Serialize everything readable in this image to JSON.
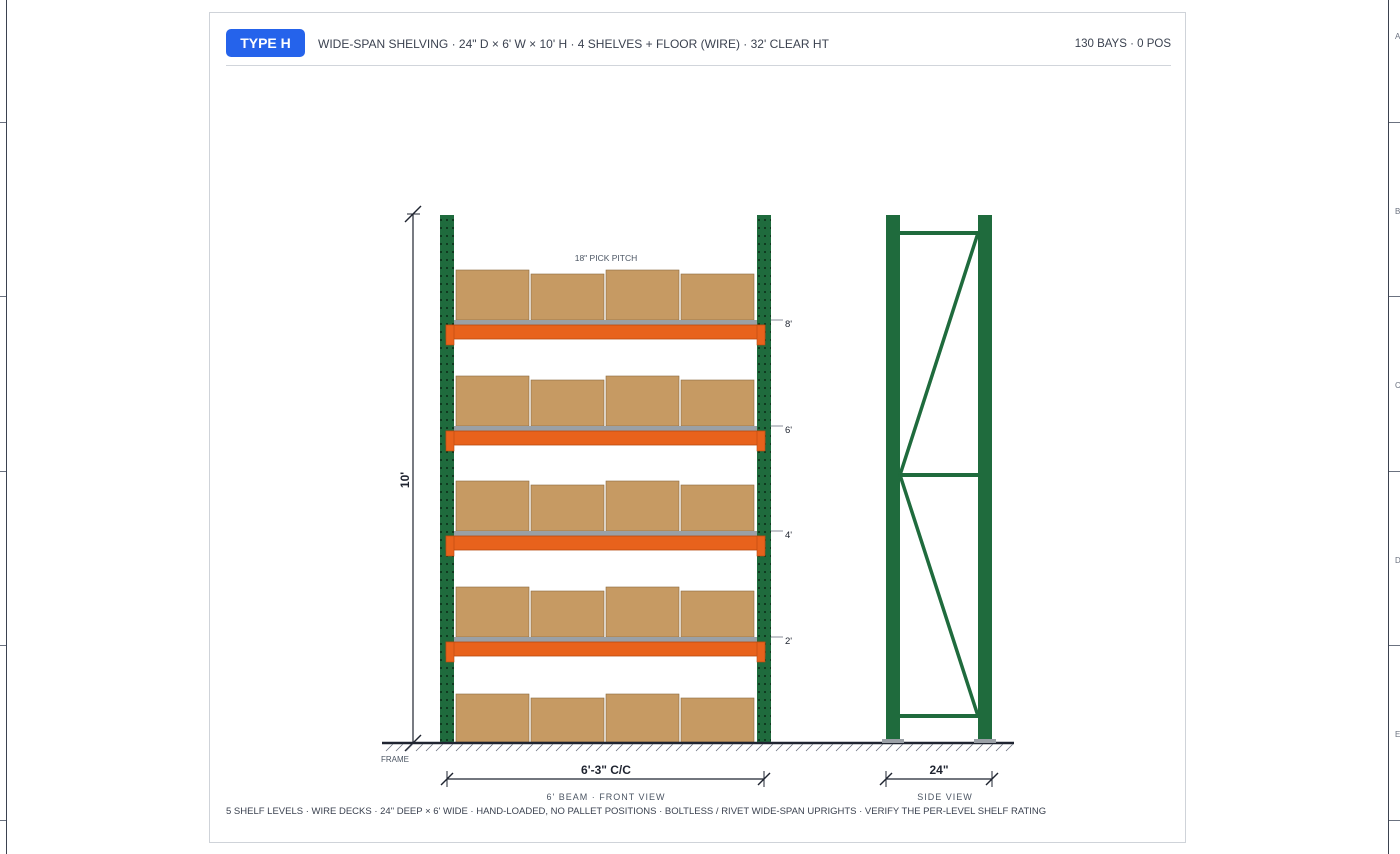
{
  "header": {
    "badge": "TYPE H",
    "description": "WIDE-SPAN SHELVING · 24\" D × 6' W × 10' H · 4 SHELVES + FLOOR (WIRE) · 32' CLEAR HT",
    "count": "130 BAYS · 0 POS"
  },
  "border": {
    "zone_letters": [
      "A",
      "B",
      "C",
      "D",
      "E"
    ]
  },
  "front_view": {
    "pitch_label": "18\" PICK PITCH",
    "level_labels": [
      "8'",
      "6'",
      "4'",
      "2'"
    ],
    "height_label": "10'",
    "frame_label": "FRAME",
    "width_dim": "6'-3\" C/C",
    "caption": "6' BEAM · FRONT VIEW"
  },
  "side_view": {
    "depth_dim": "24\"",
    "caption": "SIDE VIEW"
  },
  "footnote": "5 SHELF LEVELS · WIRE DECKS · 24\" DEEP × 6' WIDE · HAND-LOADED, NO PALLET POSITIONS · BOLTLESS / RIVET WIDE-SPAN UPRIGHTS · VERIFY THE PER-LEVEL SHELF RATING",
  "colors": {
    "upright": "#1f6b3d",
    "beam": "#e8621c",
    "carton": "#c69a63",
    "deck": "#9aa0a6",
    "accent": "#2563eb"
  }
}
